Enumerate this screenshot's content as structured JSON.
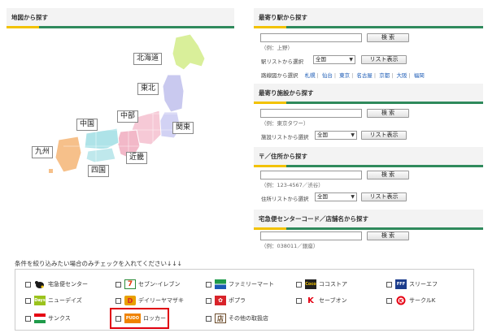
{
  "map_section": {
    "title": "地図から探す",
    "regions": {
      "hokkaido": "北海道",
      "tohoku": "東北",
      "kanto": "関東",
      "chubu": "中部",
      "kinki": "近畿",
      "chugoku": "中国",
      "shikoku": "四国",
      "kyushu": "九州"
    }
  },
  "station_section": {
    "title": "最寄り駅から探す",
    "search_label": "検 索",
    "example": "（例：上野）",
    "list_label": "駅リストから選択",
    "select_value": "全国",
    "list_button": "リスト表示",
    "route_label": "路線図から選択",
    "routes": [
      "札幌",
      "仙台",
      "東京",
      "名古屋",
      "京都",
      "大阪",
      "福岡"
    ]
  },
  "facility_section": {
    "title": "最寄り施設から探す",
    "search_label": "検 索",
    "example": "（例：東京タワー）",
    "list_label": "施設リストから選択",
    "select_value": "全国",
    "list_button": "リスト表示"
  },
  "address_section": {
    "title": "〒／住所から探す",
    "search_label": "検 索",
    "example": "（例：123-4567／渋谷）",
    "list_label": "住所リストから選択",
    "select_value": "全国",
    "list_button": "リスト表示"
  },
  "code_section": {
    "title": "宅急便センターコード／店舗名から探す",
    "search_label": "検 索",
    "example": "（例：038011／銀座）"
  },
  "conditions": {
    "title": "条件を絞り込みたい場合のみチェックを入れてください↓↓↓",
    "items": [
      {
        "label": "宅急便センター",
        "icon": "yamato-cat-icon",
        "color": "#1a1a1a"
      },
      {
        "label": "セブン-イレブン",
        "icon": "seven-eleven-icon",
        "color": "#2e8b3a"
      },
      {
        "label": "ファミリーマート",
        "icon": "familymart-icon",
        "color": "#1f9b4a"
      },
      {
        "label": "ココストア",
        "icon": "cocostore-icon",
        "color": "#222222"
      },
      {
        "label": "スリーエフ",
        "icon": "three-f-icon",
        "color": "#1b3c8c"
      },
      {
        "label": "ニューデイズ",
        "icon": "newdays-icon",
        "color": "#9bc31c"
      },
      {
        "label": "デイリーヤマザキ",
        "icon": "daily-yamazaki-icon",
        "color": "#e8a000"
      },
      {
        "label": "ポプラ",
        "icon": "poplar-icon",
        "color": "#d8232a"
      },
      {
        "label": "セーブオン",
        "icon": "saveon-icon",
        "color": "#e40012"
      },
      {
        "label": "サークルK",
        "icon": "circle-k-icon",
        "color": "#e60012"
      },
      {
        "label": "サンクス",
        "icon": "sunkus-icon",
        "color": "#e60012"
      },
      {
        "label": "ロッカー",
        "icon": "locker-icon",
        "color": "#f08300",
        "logo_text": "PUDO"
      },
      {
        "label": "その他の取扱店",
        "icon": "store-icon",
        "color": "#6b4b2a"
      }
    ]
  },
  "colors": {
    "accent_yellow": "#f2c200",
    "accent_green": "#2f8a5c",
    "link_blue": "#1a5ab5",
    "highlight_red": "#e0000e"
  }
}
